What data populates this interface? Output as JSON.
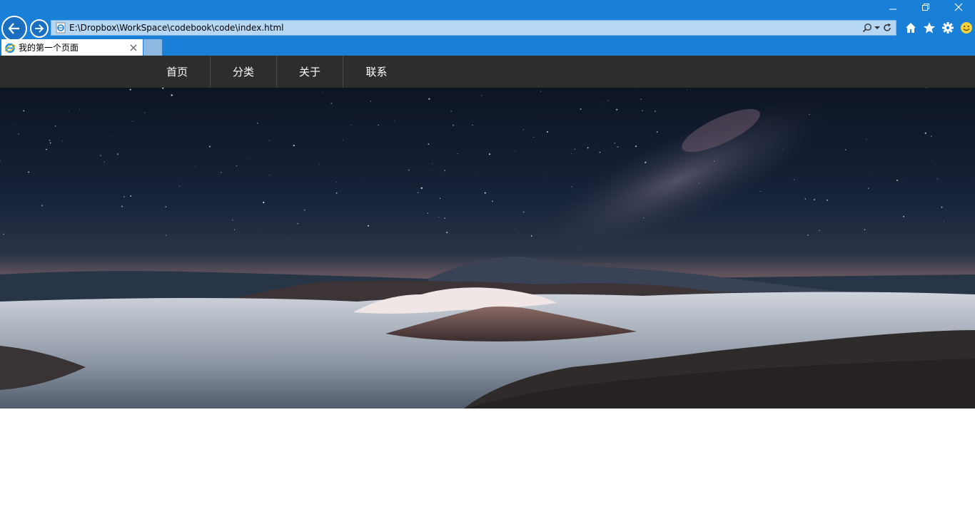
{
  "browser": {
    "url": "E:\\Dropbox\\WorkSpace\\codebook\\code\\index.html",
    "tab_title": "我的第一个页面",
    "colors": {
      "chrome": "#1a7fd6",
      "address_bar": "#b6d7f3"
    },
    "window_controls": [
      "minimize-icon",
      "restore-icon",
      "close-icon"
    ],
    "address_tools": [
      "search-icon",
      "dropdown-icon",
      "refresh-icon"
    ],
    "toolbar_icons": [
      "home-icon",
      "favorites-star-icon",
      "settings-gear-icon",
      "smiley-feedback-icon"
    ]
  },
  "site": {
    "nav": {
      "background": "#2d2d2d",
      "items": [
        "首页",
        "分类",
        "关于",
        "联系"
      ]
    },
    "hero": {
      "description_icon": "hero-landscape-image"
    }
  }
}
